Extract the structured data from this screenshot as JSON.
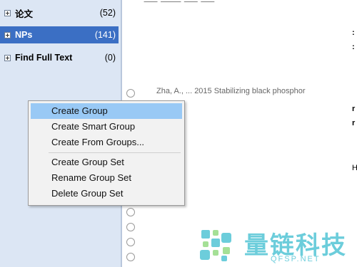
{
  "sidebar": {
    "groups": [
      {
        "name": "论文",
        "count": "(52)",
        "selected": false
      },
      {
        "name": "NPs",
        "count": "(141)",
        "selected": true
      },
      {
        "name": "Find Full Text",
        "count": "(0)",
        "selected": false
      }
    ]
  },
  "main": {
    "partial_row_text": "Zha, A., ... 2015  Stabilizing black phosphor"
  },
  "context_menu": {
    "items": [
      "Create Group",
      "Create Smart Group",
      "Create From Groups...",
      "Create Group Set",
      "Rename Group Set",
      "Delete Group Set"
    ],
    "highlighted_index": 0
  },
  "watermark": {
    "chinese": "量链科技",
    "english": "QFSP.NET"
  },
  "colors": {
    "sidebar_bg": "#dce6f4",
    "selected_bg": "#3b6fc4",
    "menu_highlight": "#99c9f5",
    "watermark": "#2fb8cc"
  }
}
